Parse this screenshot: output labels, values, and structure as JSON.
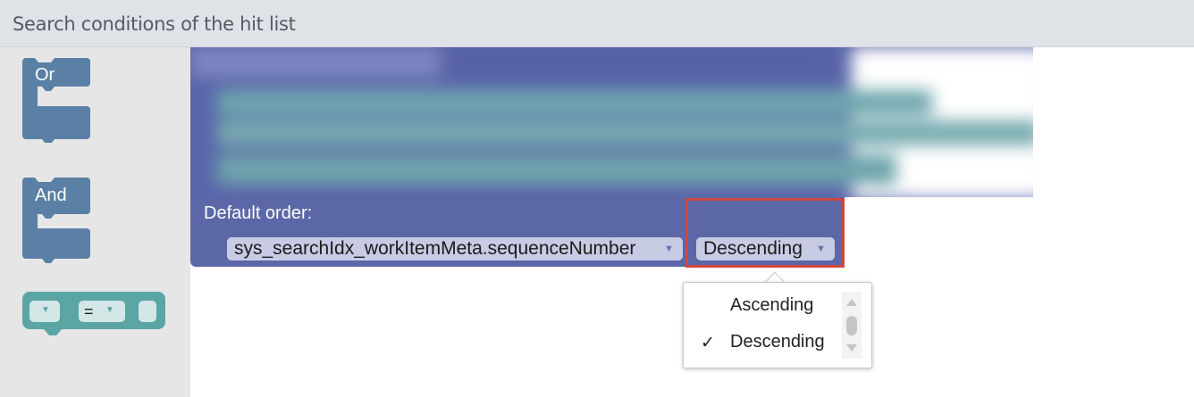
{
  "header": {
    "title": "Search conditions of the hit list"
  },
  "toolbox": {
    "or_block": {
      "label": "Or"
    },
    "and_block": {
      "label": "And"
    },
    "compare_block": {
      "operator": "="
    }
  },
  "order_block": {
    "label": "Default order:",
    "field_value": "sys_searchIdx_workItemMeta.sequenceNumber",
    "direction_value": "Descending"
  },
  "direction_menu": {
    "options": [
      "Ascending",
      "Descending"
    ],
    "selected": "Descending",
    "check_glyph": "✓"
  },
  "colors": {
    "toolbox_logic_block": "#5b80a5",
    "toolbox_compare_block": "#5ba5a5",
    "order_block": "#5c67a8",
    "highlight": "#d0473d"
  }
}
